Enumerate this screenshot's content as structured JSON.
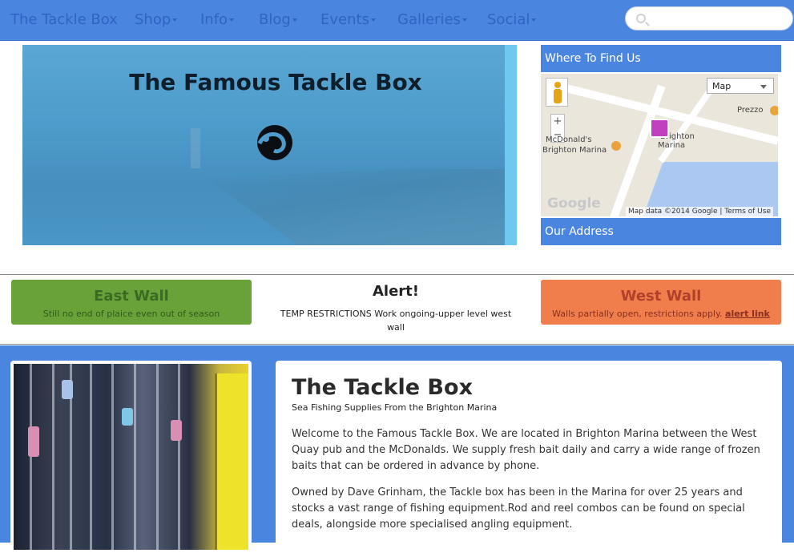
{
  "navbar": {
    "brand": "The Tackle Box",
    "items": [
      {
        "label": "Shop"
      },
      {
        "label": "Info"
      },
      {
        "label": "Blog"
      },
      {
        "label": "Events"
      },
      {
        "label": "Galleries"
      },
      {
        "label": "Social"
      }
    ],
    "search_placeholder": ""
  },
  "hero": {
    "title": "The Famous Tackle Box",
    "logo_icon": "hook-logo-icon"
  },
  "sidebar": {
    "where_title": "Where To Find Us",
    "address_title": "Our Address",
    "map": {
      "type_select": "Map",
      "labels": {
        "prezzo": "Prezzo",
        "mcdonalds": "McDonald's",
        "brighton_marina_1": "Brighton Marina",
        "brighton_marina_2": "Brighton",
        "marina": "Marina"
      },
      "zoom_in": "+",
      "zoom_out": "−",
      "google": "Google",
      "attribution": "Map data ©2014 Google",
      "terms": "Terms of Use"
    }
  },
  "alerts": {
    "east": {
      "title": "East Wall",
      "text": "Still no end of plaice even out of season"
    },
    "center": {
      "title": "Alert!",
      "text": "TEMP RESTRICTIONS Work ongoing-upper level west wall"
    },
    "west": {
      "title": "West Wall",
      "text": "Walls partially open, restrictions apply.",
      "link": "alert link"
    }
  },
  "content": {
    "title": "The Tackle Box",
    "subtitle": "Sea Fishing Supplies From the Brighton Marina",
    "paragraphs": [
      "Welcome to the Famous Tackle Box. We are located in Brighton Marina between the West Quay pub and the McDonalds. We supply fresh bait daily and carry a wide range of frozen baits that can be ordered in advance by phone.",
      "Owned by Dave Grinham, the Tackle box has been in the Marina for over 25 years and stocks a vast range of fishing equipment.Rod and reel combos can be found on special deals, alongside more specialised angling equipment."
    ]
  },
  "colors": {
    "nav_blue": "#4a86e0",
    "east_green": "#6aa23a",
    "west_orange": "#ef7e4c"
  }
}
